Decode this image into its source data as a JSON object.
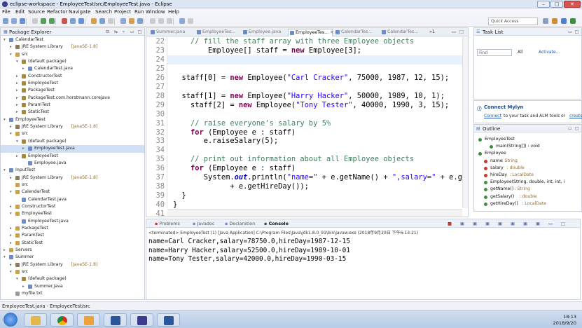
{
  "window": {
    "title": "eclipse-workspace - EmployeeTest/src/EmployeeTest.java - Eclipse"
  },
  "menu": [
    "File",
    "Edit",
    "Source",
    "Refactor",
    "Navigate",
    "Search",
    "Project",
    "Run",
    "Window",
    "Help"
  ],
  "toolbar": {
    "quick_access": "Quick Access"
  },
  "package_explorer": {
    "title": "Package Explorer",
    "rows": [
      {
        "label": "CalendarTest",
        "extra": "",
        "indent": 0,
        "arrow": "▾",
        "icon": "project-icon",
        "color": "#6b8cc7"
      },
      {
        "label": "JRE System Library",
        "extra": "[JavaSE-1.8]",
        "indent": 1,
        "arrow": "▸",
        "icon": "library-icon",
        "color": "#8a7a5a"
      },
      {
        "label": "src",
        "extra": "",
        "indent": 1,
        "arrow": "▾",
        "icon": "folder-icon",
        "color": "#c9a24a"
      },
      {
        "label": "(default package)",
        "extra": "",
        "indent": 2,
        "arrow": "▾",
        "icon": "package-icon",
        "color": "#a3873a"
      },
      {
        "label": "CalendarTest.java",
        "extra": "",
        "indent": 3,
        "arrow": "▸",
        "icon": "java-file-icon",
        "color": "#6b8cc7"
      },
      {
        "label": "ConstructorTest",
        "extra": "",
        "indent": 2,
        "arrow": "▸",
        "icon": "package-icon",
        "color": "#a3873a"
      },
      {
        "label": "EmployeeTest",
        "extra": "",
        "indent": 2,
        "arrow": "▸",
        "icon": "package-icon",
        "color": "#a3873a"
      },
      {
        "label": "PackageTest",
        "extra": "",
        "indent": 2,
        "arrow": "▸",
        "icon": "package-icon",
        "color": "#a3873a"
      },
      {
        "label": "PackageTest.com.horstmann.corejava",
        "extra": "",
        "indent": 2,
        "arrow": "▸",
        "icon": "package-icon",
        "color": "#a3873a"
      },
      {
        "label": "ParamTest",
        "extra": "",
        "indent": 2,
        "arrow": "▸",
        "icon": "package-icon",
        "color": "#a3873a"
      },
      {
        "label": "StaticTest",
        "extra": "",
        "indent": 2,
        "arrow": "▸",
        "icon": "package-icon",
        "color": "#a3873a"
      },
      {
        "label": "EmployeeTest",
        "extra": "",
        "indent": 0,
        "arrow": "▾",
        "icon": "project-icon",
        "color": "#6b8cc7"
      },
      {
        "label": "JRE System Library",
        "extra": "[JavaSE-1.8]",
        "indent": 1,
        "arrow": "▸",
        "icon": "library-icon",
        "color": "#8a7a5a"
      },
      {
        "label": "src",
        "extra": "",
        "indent": 1,
        "arrow": "▾",
        "icon": "folder-icon",
        "color": "#c9a24a"
      },
      {
        "label": "(default package)",
        "extra": "",
        "indent": 2,
        "arrow": "▾",
        "icon": "package-icon",
        "color": "#a3873a"
      },
      {
        "label": "EmployeeTest.java",
        "extra": "",
        "indent": 3,
        "arrow": "▸",
        "icon": "java-file-icon",
        "color": "#6b8cc7",
        "selected": true
      },
      {
        "label": "EmployeeTest",
        "extra": "",
        "indent": 2,
        "arrow": "▸",
        "icon": "package-icon",
        "color": "#a3873a"
      },
      {
        "label": "Employee.java",
        "extra": "",
        "indent": 3,
        "arrow": "",
        "icon": "java-file-icon",
        "color": "#6b8cc7"
      },
      {
        "label": "InputTest",
        "extra": "",
        "indent": 0,
        "arrow": "▾",
        "icon": "project-icon",
        "color": "#6b8cc7"
      },
      {
        "label": "JRE System Library",
        "extra": "[JavaSE-1.8]",
        "indent": 1,
        "arrow": "▸",
        "icon": "library-icon",
        "color": "#8a7a5a"
      },
      {
        "label": "src",
        "extra": "",
        "indent": 1,
        "arrow": "",
        "icon": "folder-icon",
        "color": "#c9a24a"
      },
      {
        "label": "CalendarTest",
        "extra": "",
        "indent": 1,
        "arrow": "▾",
        "icon": "folder-icon",
        "color": "#c9a24a"
      },
      {
        "label": "CalendarTest.java",
        "extra": "",
        "indent": 2,
        "arrow": "",
        "icon": "java-file-icon",
        "color": "#6b8cc7"
      },
      {
        "label": "ConstructorTest",
        "extra": "",
        "indent": 1,
        "arrow": "▸",
        "icon": "folder-icon",
        "color": "#c9a24a"
      },
      {
        "label": "EmployeeTest",
        "extra": "",
        "indent": 1,
        "arrow": "▾",
        "icon": "folder-icon",
        "color": "#c9a24a"
      },
      {
        "label": "EmployeeTest.java",
        "extra": "",
        "indent": 2,
        "arrow": "",
        "icon": "java-file-icon",
        "color": "#6b8cc7"
      },
      {
        "label": "PackageTest",
        "extra": "",
        "indent": 1,
        "arrow": "▸",
        "icon": "folder-icon",
        "color": "#c9a24a"
      },
      {
        "label": "ParamTest",
        "extra": "",
        "indent": 1,
        "arrow": "▸",
        "icon": "folder-icon",
        "color": "#c9a24a"
      },
      {
        "label": "StaticTest",
        "extra": "",
        "indent": 1,
        "arrow": "▸",
        "icon": "folder-icon",
        "color": "#c9a24a"
      },
      {
        "label": "Servers",
        "extra": "",
        "indent": 0,
        "arrow": "▸",
        "icon": "folder-icon",
        "color": "#c9a24a"
      },
      {
        "label": "Summer",
        "extra": "",
        "indent": 0,
        "arrow": "▾",
        "icon": "project-icon",
        "color": "#6b8cc7"
      },
      {
        "label": "JRE System Library",
        "extra": "[JavaSE-1.8]",
        "indent": 1,
        "arrow": "▸",
        "icon": "library-icon",
        "color": "#8a7a5a"
      },
      {
        "label": "src",
        "extra": "",
        "indent": 1,
        "arrow": "▾",
        "icon": "folder-icon",
        "color": "#c9a24a"
      },
      {
        "label": "(default package)",
        "extra": "",
        "indent": 2,
        "arrow": "▾",
        "icon": "package-icon",
        "color": "#a3873a"
      },
      {
        "label": "Summer.java",
        "extra": "",
        "indent": 3,
        "arrow": "▸",
        "icon": "java-file-icon",
        "color": "#6b8cc7"
      },
      {
        "label": "myfile.txt",
        "extra": "",
        "indent": 1,
        "arrow": "",
        "icon": "text-file-icon",
        "color": "#9a9a9a"
      }
    ]
  },
  "editor": {
    "tabs": [
      {
        "label": "Summer.java",
        "active": false
      },
      {
        "label": "EmployeeTes...",
        "active": false
      },
      {
        "label": "Employee.java",
        "active": false
      },
      {
        "label": "EmployeeTes...",
        "active": true
      },
      {
        "label": "CalendarTes...",
        "active": false
      },
      {
        "label": "CalendarTes...",
        "active": false
      }
    ],
    "overflow_count": "»1",
    "lines": [
      {
        "n": "22",
        "html": "    <span class=\"cm\">// fill the staff array with three Employee objects</span>"
      },
      {
        "n": "23",
        "html": "        Employee[] staff = <span class=\"kw\">new</span> Employee[3];"
      },
      {
        "n": "24",
        "html": "",
        "highlight": true
      },
      {
        "n": "25",
        "html": ""
      },
      {
        "n": "26",
        "html": "  staff[0] = <span class=\"kw\">new</span> Employee(<span class=\"st\">\"Carl Cracker\"</span>, 75000, 1987, 12, 15);"
      },
      {
        "n": "27",
        "html": ""
      },
      {
        "n": "28",
        "html": "  staff[1] = <span class=\"kw\">new</span> Employee(<span class=\"st\">\"Harry Hacker\"</span>, 50000, 1989, 10, 1);"
      },
      {
        "n": "29",
        "html": "    staff[2] = <span class=\"kw\">new</span> Employee(<span class=\"st\">\"Tony Tester\"</span>, 40000, 1990, 3, 15);"
      },
      {
        "n": "30",
        "html": ""
      },
      {
        "n": "31",
        "html": "    <span class=\"cm\">// raise everyone's salary by 5%</span>"
      },
      {
        "n": "32",
        "html": "    <span class=\"kw\">for</span> (Employee e : staff)"
      },
      {
        "n": "33",
        "html": "       e.raiseSalary(5);"
      },
      {
        "n": "34",
        "html": ""
      },
      {
        "n": "35",
        "html": "    <span class=\"cm\">// print out information about all Employee objects</span>"
      },
      {
        "n": "36",
        "html": "    <span class=\"kw\">for</span> (Employee e : staff)"
      },
      {
        "n": "37",
        "html": "       System.<span class=\"it\">out</span>.println(<span class=\"st\">\"name=\"</span> + e.getName() + <span class=\"st\">\",salary=\"</span> + e.g"
      },
      {
        "n": "38",
        "html": "             + e.getHireDay());"
      },
      {
        "n": "39",
        "html": "  }"
      },
      {
        "n": "40",
        "html": "}"
      },
      {
        "n": "41",
        "html": ""
      }
    ]
  },
  "console": {
    "tabs": [
      "Problems",
      "Javadoc",
      "Declaration",
      "Console"
    ],
    "terminated": "<terminated> EmployeeTest (1) [Java Application] C:\\Program Files\\Java\\jdk1.8.0_91\\bin\\javaw.exe (2018年9月20日 下午6:13:21)",
    "output": [
      "name=Carl Cracker,salary=78750.0,hireDay=1987-12-15",
      "name=Harry Hacker,salary=52500.0,hireDay=1989-10-01",
      "name=Tony Tester,salary=42000.0,hireDay=1990-03-15"
    ]
  },
  "task_list": {
    "title": "Task List",
    "find_placeholder": "Find",
    "all": "All",
    "activate": "Activate..."
  },
  "mylyn": {
    "title": "Connect Mylyn",
    "link": "Connect",
    "text": "to your task and ALM tools or",
    "link2": "create"
  },
  "outline": {
    "title": "Outline",
    "rows": [
      {
        "label": "EmployeeTest",
        "type": "",
        "indent": 0,
        "dot": "#3c8f3c"
      },
      {
        "label": "main(String[]) : void",
        "type": "",
        "indent": 2,
        "dot": "#3c8f3c"
      },
      {
        "label": "Employee",
        "type": "",
        "indent": 0,
        "dot": "#3c8f3c"
      },
      {
        "label": "name",
        "type": " : String",
        "indent": 1,
        "dot": "#c0392b"
      },
      {
        "label": "salary",
        "type": " : double",
        "indent": 1,
        "dot": "#c0392b"
      },
      {
        "label": "hireDay",
        "type": " : LocalDate",
        "indent": 1,
        "dot": "#c0392b"
      },
      {
        "label": "Employee(String, double, int, int, i",
        "type": "",
        "indent": 1,
        "dot": "#3c8f3c"
      },
      {
        "label": "getName()",
        "type": " : String",
        "indent": 1,
        "dot": "#3c8f3c"
      },
      {
        "label": "getSalary()",
        "type": " : double",
        "indent": 1,
        "dot": "#3c8f3c"
      },
      {
        "label": "getHireDay()",
        "type": " : LocalDate",
        "indent": 1,
        "dot": "#3c8f3c"
      }
    ]
  },
  "status": {
    "text": "EmployeeTest.java - EmployeeTest/src"
  },
  "taskbar": {
    "time": "18:13",
    "date": "2018/9/20"
  }
}
